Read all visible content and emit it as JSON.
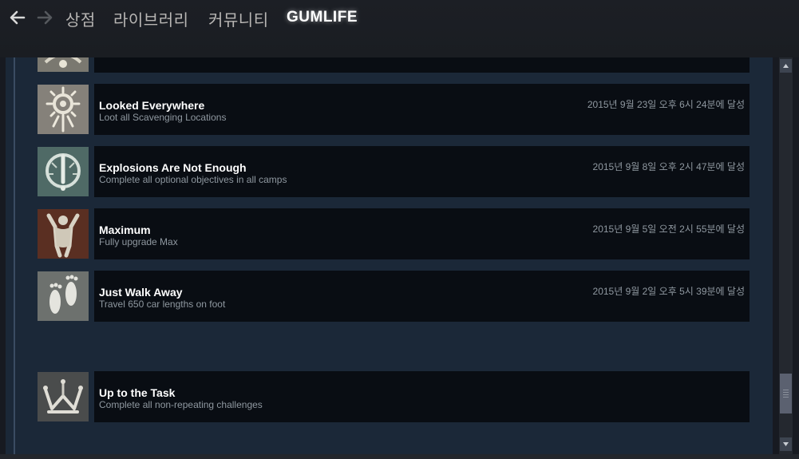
{
  "nav": {
    "store": "상점",
    "library": "라이브러리",
    "community": "커뮤니티",
    "user": "GUMLIFE"
  },
  "achievements": [
    {
      "title": "",
      "desc": "",
      "date": "",
      "icon": "partial-achievement-icon"
    },
    {
      "title": "Looked Everywhere",
      "desc": "Loot all Scavenging Locations",
      "date": "2015년 9월 23일 오후 6시 24분에 달성",
      "icon": "eye-sun-icon"
    },
    {
      "title": "Explosions Are Not Enough",
      "desc": "Complete all optional objectives in all camps",
      "date": "2015년 9월 8일 오후 2시 47분에 달성",
      "icon": "explosion-icon"
    },
    {
      "title": "Maximum",
      "desc": "Fully upgrade Max",
      "date": "2015년 9월 5일 오전 2시 55분에 달성",
      "icon": "max-figure-icon"
    },
    {
      "title": "Just Walk Away",
      "desc": "Travel 650 car lengths on foot",
      "date": "2015년 9월 2일 오후 5시 39분에 달성",
      "icon": "footprints-icon"
    },
    {
      "title": "Up to the Task",
      "desc": "Complete all non-repeating challenges",
      "date": "",
      "icon": "crown-icon"
    }
  ],
  "colors": {
    "background": "#1b2838",
    "row_panel": "#090d13",
    "title_text": "#ffffff",
    "desc_text": "#8f98a0"
  }
}
